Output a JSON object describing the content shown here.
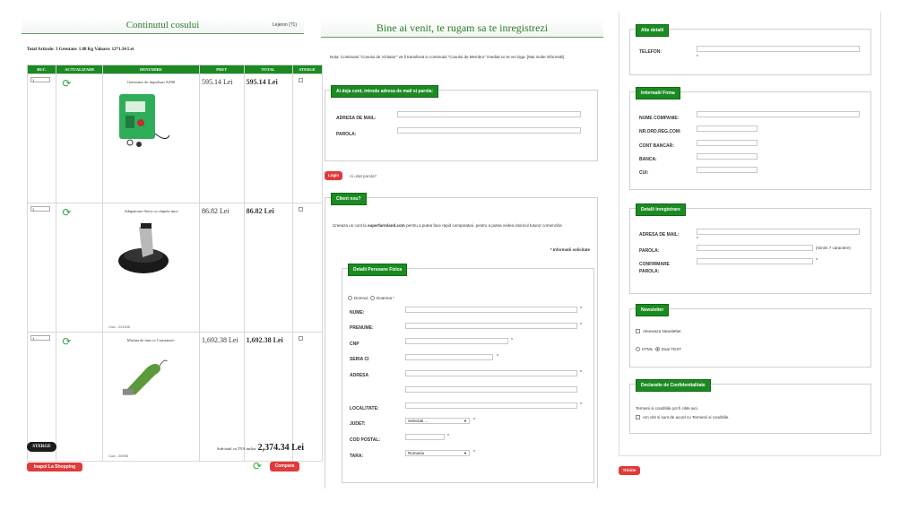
{
  "cart": {
    "title": "Continutul cosului",
    "header_link": "Lejeron (?1)",
    "summary": "Total Articole: 3  Greutate: 1.88 Kg  Valoare: 12*1.34 Lei",
    "columns": [
      "BUC.",
      "ACTUALIZARE",
      "DENUMIRE",
      "PRET",
      "TOTAL",
      "STERGE"
    ],
    "items": [
      {
        "qty": "1",
        "name": "Generator de impulsuri AZ00",
        "badge": "",
        "code": "",
        "price": "595.14 Lei",
        "total": "595.14 Lei"
      },
      {
        "qty": "1",
        "name": "Adapatoare flotor cu clapeta inox",
        "badge": "",
        "code": "Cod - 221100",
        "price": "86.82 Lei",
        "total": "86.82 Lei"
      },
      {
        "qty": "1",
        "name": "Masina de tuns oi Constanta+",
        "badge": "",
        "code": "Cod - 20993",
        "price": "1,692.38 Lei",
        "total": "1,692.38 Lei"
      }
    ],
    "delete_button": "STERGE",
    "subtotal_label": "Sub-total cu TVA inclus:",
    "subtotal_value": "2,374.34 Lei",
    "shopping_button": "Inapoi La Shopping",
    "compare_button": "Compara"
  },
  "register": {
    "title": "Bine ai venit, te rugam sa te inregistrezi",
    "note": "Nota: Continutul \"Cosului de Vizitator\" va fi transferat in continutul \"Cosului de Membru\" imediat ce te vei loga. [Mai multe informatii]",
    "login_legend": "Ai deja cont, introdu adresa de mail si parola:",
    "email_label": "ADRESA DE MAIL:",
    "password_label": "PAROLA:",
    "login_button": "Login",
    "forgot_link": "Ai uitat parola?",
    "new_client_legend": "Client nou?",
    "new_client_text_1": "Creeaza un cont la",
    "new_client_site": "superfarmland.com",
    "new_client_text_2": "pentru a putea face rapid cumparaturi, pentru a putea vedea istoricul tuturor comenzilor.",
    "required_note": "* Informatii solicitate",
    "person_legend": "Detalii Persoane Fizica",
    "radio_mr": "Domnul",
    "radio_mrs": "Doamna",
    "fields": {
      "nume": "NUME:",
      "prenume": "PRENUME:",
      "cnp": "CNP",
      "seria": "SERIA CI",
      "adresa": "ADRESA",
      "localitate": "LOCALITATE:",
      "judet": "JUDET:",
      "cod_postal": "COD POSTAL:",
      "tara": "TARA:"
    },
    "judet_value": "Selectati ...",
    "tara_value": "Romania"
  },
  "other": {
    "alte_legend": "Alte detalii",
    "telefon_label": "TELEFON:",
    "firma_legend": "Informatii Firma",
    "nume_companie": "NUME COMPANIE:",
    "nr_ord": "NR.ORD.REG.COM:",
    "cont_bancar": "CONT BANCAR:",
    "banca": "BANCA:",
    "cui": "CUI:",
    "inreg_legend": "Detalii inregistrare",
    "adresa_mail": "ADRESA DE MAIL:",
    "parola": "PAROLA:",
    "parola_hint": "(minim 7 caractere)",
    "confirmare": "CONFIRMARE PAROLA:",
    "newsletter_legend": "Newsletter",
    "newsletter_option": "Aboneaza Newsletter.",
    "html_option": "HTML",
    "text_option": "Doar TEXT",
    "confid_legend": "Declaratie de Confidentialitate",
    "terms_text": "Termeni si conditiile pot fi citite aici.",
    "terms_check": "Am citit si sunt de acord cu Termenii si conditiile.",
    "submit_button": "Trimite"
  },
  "colors": {
    "accent_green": "#1b8a22",
    "button_red": "#e03a3a",
    "title_green": "#2f7a2f"
  },
  "icons": [
    "refresh-icon",
    "checkbox-icon",
    "radio-icon",
    "dropdown-arrow-icon"
  ]
}
